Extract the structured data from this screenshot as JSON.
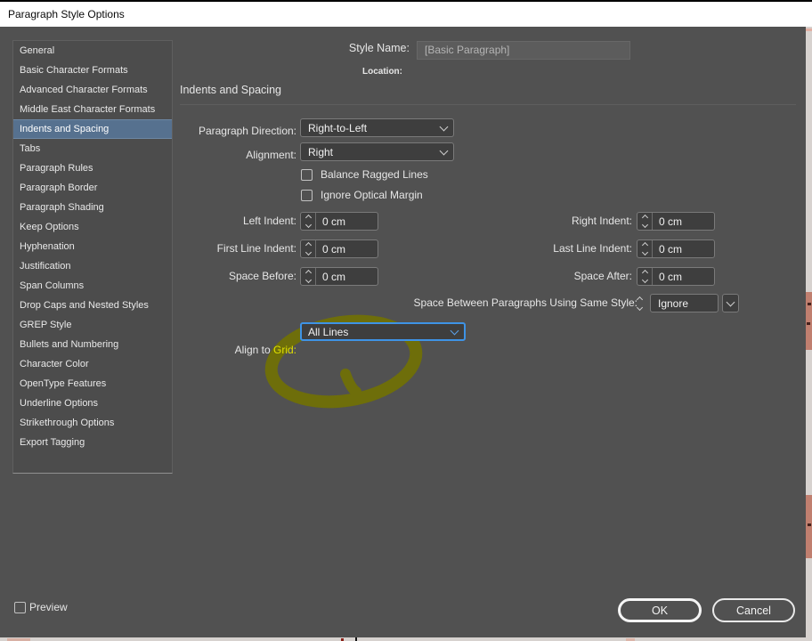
{
  "window": {
    "title": "Paragraph Style Options"
  },
  "sidebar": {
    "items": [
      {
        "label": "General",
        "selected": false
      },
      {
        "label": "Basic Character Formats",
        "selected": false
      },
      {
        "label": "Advanced Character Formats",
        "selected": false
      },
      {
        "label": "Middle East Character Formats",
        "selected": false
      },
      {
        "label": "Indents and Spacing",
        "selected": true
      },
      {
        "label": "Tabs",
        "selected": false
      },
      {
        "label": "Paragraph Rules",
        "selected": false
      },
      {
        "label": "Paragraph Border",
        "selected": false
      },
      {
        "label": "Paragraph Shading",
        "selected": false
      },
      {
        "label": "Keep Options",
        "selected": false
      },
      {
        "label": "Hyphenation",
        "selected": false
      },
      {
        "label": "Justification",
        "selected": false
      },
      {
        "label": "Span Columns",
        "selected": false
      },
      {
        "label": "Drop Caps and Nested Styles",
        "selected": false
      },
      {
        "label": "GREP Style",
        "selected": false
      },
      {
        "label": "Bullets and Numbering",
        "selected": false
      },
      {
        "label": "Character Color",
        "selected": false
      },
      {
        "label": "OpenType Features",
        "selected": false
      },
      {
        "label": "Underline Options",
        "selected": false
      },
      {
        "label": "Strikethrough Options",
        "selected": false
      },
      {
        "label": "Export Tagging",
        "selected": false
      }
    ]
  },
  "header": {
    "style_name_label": "Style Name:",
    "style_name_value": "[Basic Paragraph]",
    "location_label": "Location:",
    "section_title": "Indents and Spacing"
  },
  "form": {
    "paragraph_direction": {
      "label": "Paragraph Direction:",
      "value": "Right-to-Left"
    },
    "alignment": {
      "label": "Alignment:",
      "value": "Right"
    },
    "balance_ragged_lines": {
      "label": "Balance Ragged Lines",
      "checked": false
    },
    "ignore_optical_margin": {
      "label": "Ignore Optical Margin",
      "checked": false
    },
    "left_indent": {
      "label": "Left Indent:",
      "value": "0 cm"
    },
    "right_indent": {
      "label": "Right Indent:",
      "value": "0 cm"
    },
    "first_line_indent": {
      "label": "First Line Indent:",
      "value": "0 cm"
    },
    "last_line_indent": {
      "label": "Last Line Indent:",
      "value": "0 cm"
    },
    "space_before": {
      "label": "Space Before:",
      "value": "0 cm"
    },
    "space_after": {
      "label": "Space After:",
      "value": "0 cm"
    },
    "space_between_same_style": {
      "label": "Space Between Paragraphs Using Same Style:",
      "value": "Ignore"
    },
    "align_to_grid": {
      "label_prefix": "Align to ",
      "label_highlight": "Grid:",
      "value": "All Lines"
    }
  },
  "footer": {
    "preview_label": "Preview",
    "ok_label": "OK",
    "cancel_label": "Cancel"
  },
  "annotation": {
    "type": "hand-drawn-marker-ellipse",
    "target": "align-to-grid-dropdown",
    "color": "#6e6e0a"
  },
  "colors": {
    "dialog_bg": "#515151",
    "sidebar_bg": "#4c4c4c",
    "selected_item_bg": "#56718f",
    "field_bg": "#3e3e3e",
    "field_border": "#7a7a7a",
    "focus_blue": "#3e93e6",
    "highlight_yellow": "#e0e000",
    "marker_olive": "#6e6e0a",
    "background_document_salmon": "#c07f6f"
  }
}
